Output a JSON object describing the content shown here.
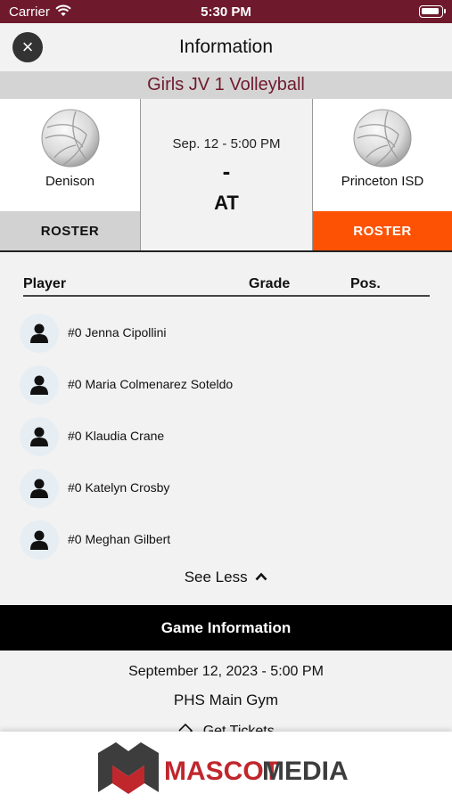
{
  "status_bar": {
    "carrier": "Carrier",
    "time": "5:30 PM"
  },
  "nav": {
    "title": "Information",
    "close_icon": "×"
  },
  "game": {
    "title": "Girls JV 1 Volleyball",
    "datetime": "Sep. 12 - 5:00 PM",
    "score": "-",
    "location_flag": "AT"
  },
  "teams": [
    {
      "name": "Denison",
      "roster_label": "ROSTER"
    },
    {
      "name": "Princeton ISD",
      "roster_label": "ROSTER"
    }
  ],
  "roster": {
    "columns": [
      "Player",
      "Grade",
      "Pos."
    ],
    "players": [
      {
        "name": "#0 Jenna Cipollini",
        "grade": "",
        "pos": ""
      },
      {
        "name": "#0 Maria Colmenarez Soteldo",
        "grade": "",
        "pos": ""
      },
      {
        "name": "#0 Klaudia Crane",
        "grade": "",
        "pos": ""
      },
      {
        "name": "#0 Katelyn Crosby",
        "grade": "",
        "pos": ""
      },
      {
        "name": "#0 Meghan Gilbert",
        "grade": "",
        "pos": ""
      }
    ],
    "see_less_label": "See Less"
  },
  "game_information": {
    "header": "Game Information",
    "date": "September 12, 2023 - 5:00 PM",
    "venue": "PHS Main Gym",
    "tickets_label": "Get Tickets"
  },
  "footer": {
    "brand_bold": "MASCOT",
    "brand_light": "MEDIA"
  },
  "colors": {
    "maroon": "#6e1a2c",
    "orange": "#fd5204",
    "black": "#000000",
    "logo_red": "#c0272d",
    "logo_gray": "#3d3d3d"
  },
  "icons": [
    "close-icon",
    "wifi-icon",
    "battery-icon",
    "volleyball-icon",
    "person-icon",
    "chevron-up-icon",
    "ticket-icon"
  ]
}
